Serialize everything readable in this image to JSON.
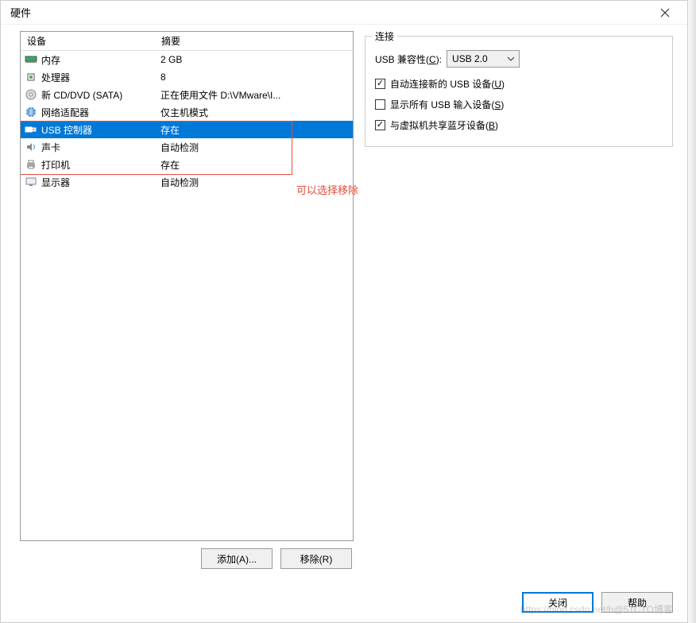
{
  "title": "硬件",
  "columns": {
    "device": "设备",
    "summary": "摘要"
  },
  "devices": [
    {
      "icon": "memory-icon",
      "name": "内存",
      "summary": "2 GB",
      "selected": false
    },
    {
      "icon": "cpu-icon",
      "name": "处理器",
      "summary": "8",
      "selected": false
    },
    {
      "icon": "cd-icon",
      "name": "新 CD/DVD (SATA)",
      "summary": "正在使用文件 D:\\VMware\\I...",
      "selected": false
    },
    {
      "icon": "network-icon",
      "name": "网络适配器",
      "summary": "仅主机模式",
      "selected": false
    },
    {
      "icon": "usb-icon",
      "name": "USB 控制器",
      "summary": "存在",
      "selected": true
    },
    {
      "icon": "sound-icon",
      "name": "声卡",
      "summary": "自动检测",
      "selected": false
    },
    {
      "icon": "printer-icon",
      "name": "打印机",
      "summary": "存在",
      "selected": false
    },
    {
      "icon": "display-icon",
      "name": "显示器",
      "summary": "自动检测",
      "selected": false
    }
  ],
  "annotation": "可以选择移除",
  "buttons": {
    "add": "添加(A)...",
    "remove": "移除(R)",
    "close": "关闭",
    "help": "帮助"
  },
  "connection": {
    "group_title": "连接",
    "compat_label_pre": "USB 兼容性(",
    "compat_label_key": "C",
    "compat_label_post": "):",
    "compat_value": "USB 2.0",
    "cb1_pre": "自动连接新的 USB 设备(",
    "cb1_key": "U",
    "cb1_post": ")",
    "cb1_checked": true,
    "cb2_pre": "显示所有 USB 输入设备(",
    "cb2_key": "S",
    "cb2_post": ")",
    "cb2_checked": false,
    "cb3_pre": "与虚拟机共享蓝牙设备(",
    "cb3_key": "B",
    "cb3_post": ")",
    "cb3_checked": true
  },
  "watermark": "https://blog.csdn.net/h@51CTO博客"
}
